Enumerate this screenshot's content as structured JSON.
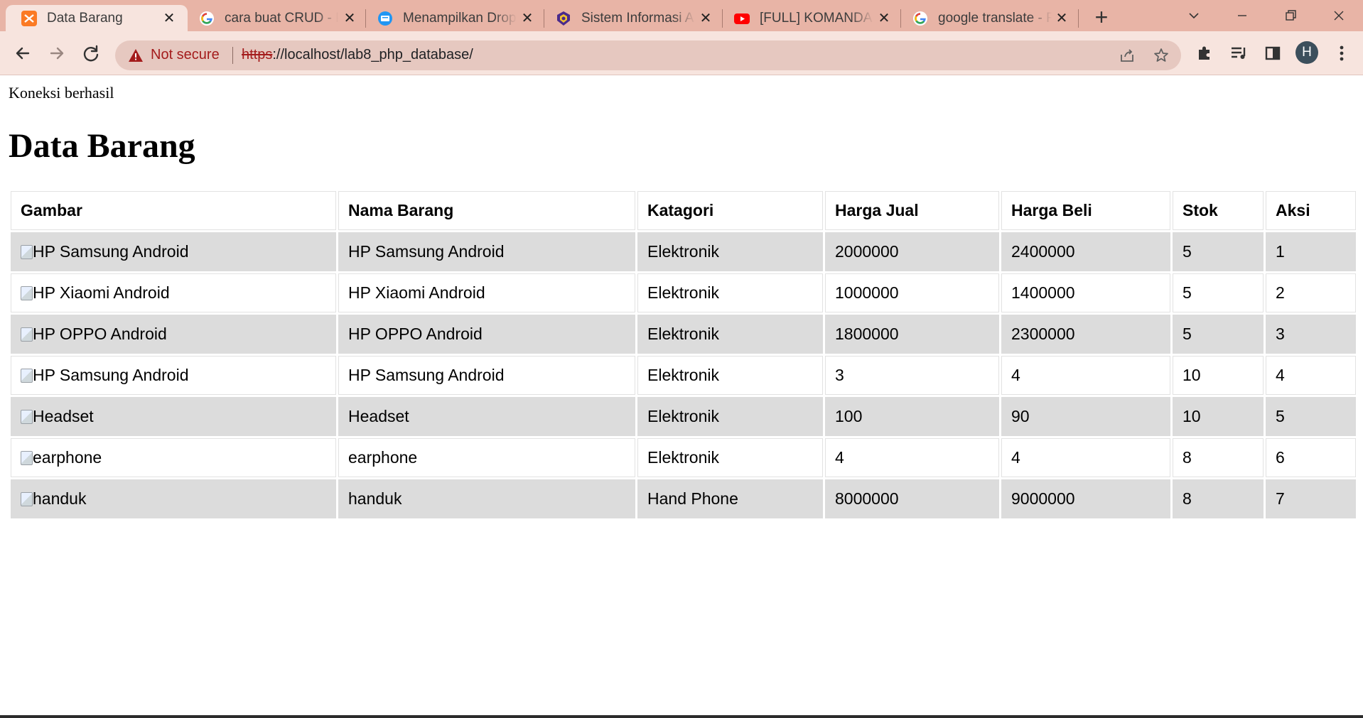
{
  "browser": {
    "tabs": [
      {
        "title": "Data Barang",
        "icon": "xampp-icon",
        "active": true
      },
      {
        "title": "cara buat CRUD - P",
        "icon": "google-icon",
        "active": false
      },
      {
        "title": "Menampilkan Drop",
        "icon": "blog-icon",
        "active": false
      },
      {
        "title": "Sistem Informasi Al",
        "icon": "university-icon",
        "active": false
      },
      {
        "title": "[FULL] KOMANDAN",
        "icon": "youtube-icon",
        "active": false
      },
      {
        "title": "google translate - F",
        "icon": "google-icon",
        "active": false
      }
    ],
    "colors": {
      "frame": "#e8b4a6",
      "toolbar": "#f7e4de",
      "omnibox": "#e6c8c0",
      "warning": "#a41c1c"
    },
    "omnibox": {
      "security_label": "Not secure",
      "url_scheme": "https",
      "url_rest": "://localhost/lab8_php_database/"
    },
    "profile_initial": "H"
  },
  "page": {
    "status_text": "Koneksi berhasil",
    "title": "Data Barang",
    "table": {
      "headers": [
        "Gambar",
        "Nama Barang",
        "Katagori",
        "Harga Jual",
        "Harga Beli",
        "Stok",
        "Aksi"
      ],
      "rows": [
        {
          "gambar_alt": "HP Samsung Android",
          "nama": "HP Samsung Android",
          "kategori": "Elektronik",
          "harga_jual": "2000000",
          "harga_beli": "2400000",
          "stok": "5",
          "aksi": "1"
        },
        {
          "gambar_alt": "HP Xiaomi Android",
          "nama": "HP Xiaomi Android",
          "kategori": "Elektronik",
          "harga_jual": "1000000",
          "harga_beli": "1400000",
          "stok": "5",
          "aksi": "2"
        },
        {
          "gambar_alt": "HP OPPO Android",
          "nama": "HP OPPO Android",
          "kategori": "Elektronik",
          "harga_jual": "1800000",
          "harga_beli": "2300000",
          "stok": "5",
          "aksi": "3"
        },
        {
          "gambar_alt": "HP Samsung Android",
          "nama": "HP Samsung Android",
          "kategori": "Elektronik",
          "harga_jual": "3",
          "harga_beli": "4",
          "stok": "10",
          "aksi": "4"
        },
        {
          "gambar_alt": "Headset",
          "nama": "Headset",
          "kategori": "Elektronik",
          "harga_jual": "100",
          "harga_beli": "90",
          "stok": "10",
          "aksi": "5"
        },
        {
          "gambar_alt": "earphone",
          "nama": "earphone",
          "kategori": "Elektronik",
          "harga_jual": "4",
          "harga_beli": "4",
          "stok": "8",
          "aksi": "6"
        },
        {
          "gambar_alt": "handuk",
          "nama": "handuk",
          "kategori": "Hand Phone",
          "harga_jual": "8000000",
          "harga_beli": "9000000",
          "stok": "8",
          "aksi": "7"
        }
      ]
    }
  }
}
